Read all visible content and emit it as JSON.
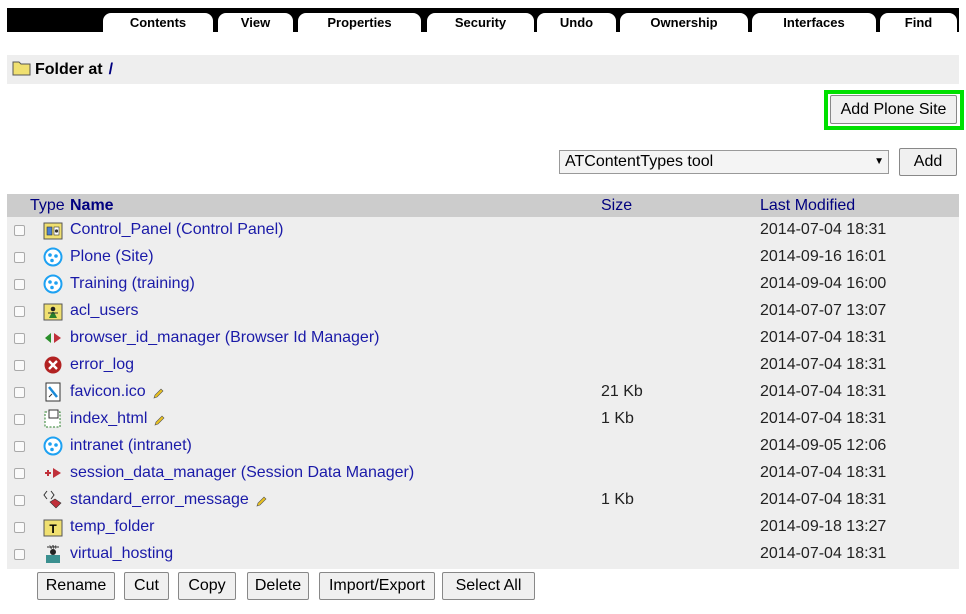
{
  "tabs": [
    "Contents",
    "View",
    "Properties",
    "Security",
    "Undo",
    "Ownership",
    "Interfaces",
    "Find"
  ],
  "header": {
    "label": "Folder at",
    "path": "/"
  },
  "add_site_button": "Add Plone Site",
  "add_select": {
    "selected": "ATContentTypes tool",
    "button": "Add"
  },
  "columns": {
    "type": "Type",
    "name": "Name",
    "size": "Size",
    "modified": "Last Modified"
  },
  "items": [
    {
      "name": "Control_Panel (Control Panel)",
      "size": "",
      "modified": "2014-07-04 18:31",
      "icon": "control-panel-icon",
      "editable": false
    },
    {
      "name": "Plone (Site)",
      "size": "",
      "modified": "2014-09-16 16:01",
      "icon": "plone-site-icon",
      "editable": false
    },
    {
      "name": "Training (training)",
      "size": "",
      "modified": "2014-09-04 16:00",
      "icon": "plone-site-icon",
      "editable": false
    },
    {
      "name": "acl_users",
      "size": "",
      "modified": "2014-07-07 13:07",
      "icon": "user-folder-icon",
      "editable": false
    },
    {
      "name": "browser_id_manager (Browser Id Manager)",
      "size": "",
      "modified": "2014-07-04 18:31",
      "icon": "browser-id-icon",
      "editable": false
    },
    {
      "name": "error_log",
      "size": "",
      "modified": "2014-07-04 18:31",
      "icon": "error-log-icon",
      "editable": false
    },
    {
      "name": "favicon.ico",
      "size": "21 Kb",
      "modified": "2014-07-04 18:31",
      "icon": "image-icon",
      "editable": true
    },
    {
      "name": "index_html",
      "size": "1 Kb",
      "modified": "2014-07-04 18:31",
      "icon": "page-template-icon",
      "editable": true
    },
    {
      "name": "intranet (intranet)",
      "size": "",
      "modified": "2014-09-05 12:06",
      "icon": "plone-site-icon",
      "editable": false
    },
    {
      "name": "session_data_manager (Session Data Manager)",
      "size": "",
      "modified": "2014-07-04 18:31",
      "icon": "session-data-icon",
      "editable": false
    },
    {
      "name": "standard_error_message",
      "size": "1 Kb",
      "modified": "2014-07-04 18:31",
      "icon": "dtml-method-icon",
      "editable": true
    },
    {
      "name": "temp_folder",
      "size": "",
      "modified": "2014-09-18 13:27",
      "icon": "temp-folder-icon",
      "editable": false
    },
    {
      "name": "virtual_hosting",
      "size": "",
      "modified": "2014-07-04 18:31",
      "icon": "virtual-host-icon",
      "editable": false
    }
  ],
  "actions": [
    "Rename",
    "Cut",
    "Copy",
    "Delete",
    "Import/Export",
    "Select All"
  ],
  "colors": {
    "link": "#1a1aa8",
    "header_link": "#00007f",
    "highlight": "#00e000"
  }
}
